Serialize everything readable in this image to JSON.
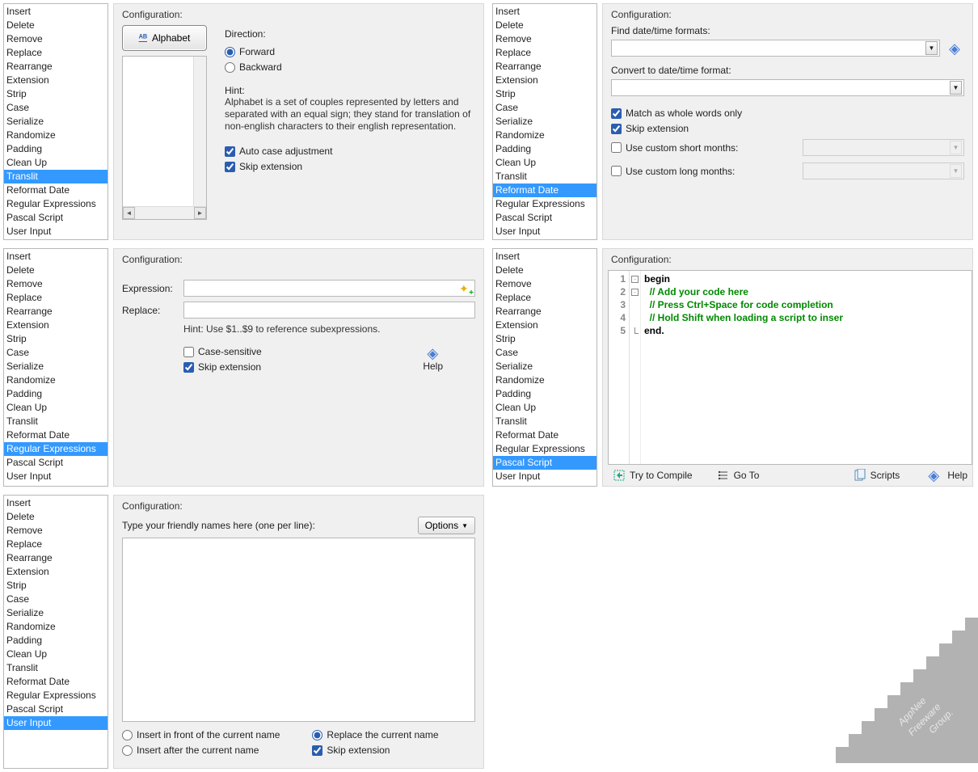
{
  "list_items": [
    "Insert",
    "Delete",
    "Remove",
    "Replace",
    "Rearrange",
    "Extension",
    "Strip",
    "Case",
    "Serialize",
    "Randomize",
    "Padding",
    "Clean Up",
    "Translit",
    "Reformat Date",
    "Regular Expressions",
    "Pascal Script",
    "User Input"
  ],
  "cfg_title": "Configuration:",
  "translit": {
    "alphabet_label": "Alphabet",
    "direction_label": "Direction:",
    "forward": "Forward",
    "backward": "Backward",
    "hint_label": "Hint:",
    "hint_text": "Alphabet is a set of couples represented by letters and separated with an equal sign; they stand for translation of non-english characters to their english representation.",
    "autocase": "Auto case adjustment",
    "skipext": "Skip extension"
  },
  "reformat": {
    "find_label": "Find date/time formats:",
    "convert_label": "Convert to date/time format:",
    "match_whole": "Match as whole words only",
    "skipext": "Skip extension",
    "custom_short": "Use custom short months:",
    "custom_long": "Use custom long months:"
  },
  "regex": {
    "expr_label": "Expression:",
    "repl_label": "Replace:",
    "hint": "Hint: Use $1..$9 to reference subexpressions.",
    "case_sens": "Case-sensitive",
    "skipext": "Skip extension",
    "help": "Help"
  },
  "pascal": {
    "lines": [
      {
        "n": "1",
        "text": "begin",
        "cls": "kw",
        "fold": "minus"
      },
      {
        "n": "2",
        "text": "  // Add your code here",
        "cls": "com",
        "fold": "minus"
      },
      {
        "n": "3",
        "text": "  // Press Ctrl+Space for code completion",
        "cls": "com",
        "fold": ""
      },
      {
        "n": "4",
        "text": "  // Hold Shift when loading a script to inser",
        "cls": "com",
        "fold": ""
      },
      {
        "n": "5",
        "text": "end.",
        "cls": "kw",
        "fold": "end"
      }
    ],
    "toolbar": {
      "compile": "Try to Compile",
      "goto": "Go To",
      "scripts": "Scripts",
      "help": "Help"
    }
  },
  "userinput": {
    "label": "Type your friendly names here (one per line):",
    "options": "Options",
    "radio_front": "Insert in front of the current name",
    "radio_after": "Insert after the current name",
    "radio_replace": "Replace the current name",
    "skipext": "Skip extension"
  },
  "watermark": {
    "l1": "AppNee",
    "l2": "Freeware",
    "l3": "Group."
  }
}
